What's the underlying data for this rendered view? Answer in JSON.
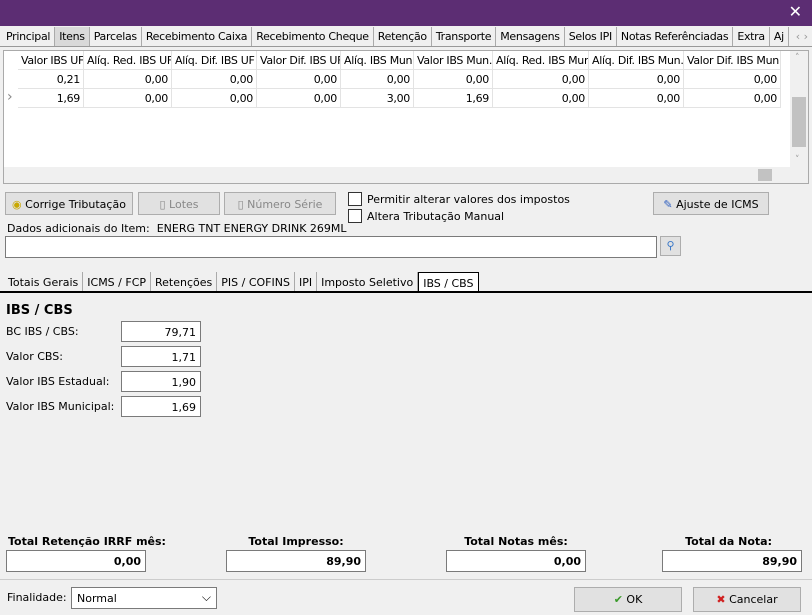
{
  "window": {
    "close_icon": "close-icon",
    "title_color": "#5c2d73"
  },
  "tabs": [
    "Principal",
    "Itens",
    "Parcelas",
    "Recebimento Caixa",
    "Recebimento Cheque",
    "Retenção",
    "Transporte",
    "Mensagens",
    "Selos IPI",
    "Notas Referênciadas",
    "Extra",
    "Aj"
  ],
  "active_tab": "Itens",
  "grid": {
    "columns": [
      "Valor IBS UF",
      "Alíq. Red. IBS UF",
      "Alíq. Dif. IBS UF",
      "Valor Dif. IBS UF",
      "Alíq. IBS Mun.",
      "Valor IBS Mun.",
      "Alíq. Red. IBS Mun.",
      "Alíq. Dif. IBS Mun.",
      "Valor Dif. IBS Mun."
    ],
    "rows": [
      [
        "0,21",
        "0,00",
        "0,00",
        "0,00",
        "0,00",
        "0,00",
        "0,00",
        "0,00",
        "0,00"
      ],
      [
        "1,69",
        "0,00",
        "0,00",
        "0,00",
        "3,00",
        "1,69",
        "0,00",
        "0,00",
        "0,00"
      ]
    ]
  },
  "buttons": {
    "corrige": "Corrige Tributação",
    "lotes": "Lotes",
    "numero_serie": "Número Série",
    "ajuste_icms": "Ajuste de ICMS",
    "ok": "OK",
    "cancelar": "Cancelar"
  },
  "checks": {
    "permitir": "Permitir alterar valores dos impostos",
    "altera": "Altera Tributação Manual"
  },
  "dados": {
    "label": "Dados adicionais do Item:",
    "value": "ENERG TNT ENERGY DRINK 269ML",
    "input": ""
  },
  "subtabs": [
    "Totais Gerais",
    "ICMS / FCP",
    "Retenções",
    "PIS / COFINS",
    "IPI",
    "Imposto Seletivo",
    "IBS / CBS"
  ],
  "panel": {
    "title": "IBS / CBS",
    "fields": [
      {
        "label": "BC IBS / CBS:",
        "value": "79,71"
      },
      {
        "label": "Valor CBS:",
        "value": "1,71"
      },
      {
        "label": "Valor IBS Estadual:",
        "value": "1,90"
      },
      {
        "label": "Valor IBS Municipal:",
        "value": "1,69"
      }
    ]
  },
  "totals": [
    {
      "label": "Total Retenção IRRF mês:",
      "value": "0,00"
    },
    {
      "label": "Total Impresso:",
      "value": "89,90"
    },
    {
      "label": "Total Notas mês:",
      "value": "0,00"
    },
    {
      "label": "Total da Nota:",
      "value": "89,90"
    }
  ],
  "finalidade": {
    "label": "Finalidade:",
    "value": "Normal"
  }
}
